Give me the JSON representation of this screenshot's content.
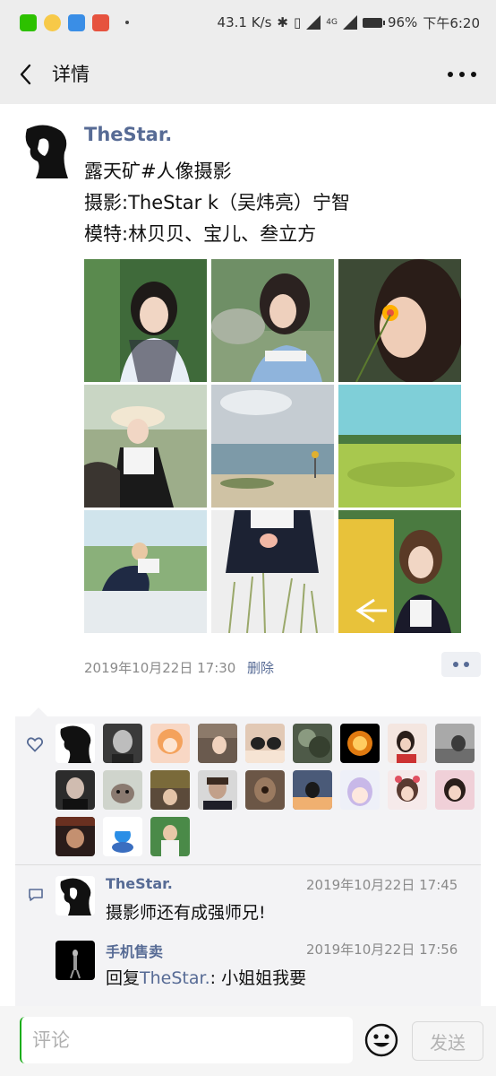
{
  "status_bar": {
    "network_speed": "43.1 K/s",
    "battery": "96%",
    "time": "下午6:20",
    "app_icons": [
      "wechat-icon",
      "qq-icon",
      "app-icon",
      "weibo-icon"
    ],
    "colors": {
      "wechat": "#2dc100",
      "qq": "#f7c948",
      "app": "#3a8ee6",
      "weibo": "#e6533f"
    }
  },
  "header": {
    "title": "详情"
  },
  "post": {
    "author": "TheStar.",
    "lines": [
      "露天矿#人像摄影",
      "摄影:TheStar k（吴炜亮）宁智",
      "模特:林贝贝、宝儿、叁立方"
    ],
    "photos": [
      "portrait-girl-garden",
      "portrait-girl-lakeside",
      "portrait-girl-flower",
      "girl-sitting-bench",
      "beach-landscape",
      "yellow-wetland",
      "girl-crouching-shore",
      "girl-in-grass",
      "girl-yellow-sign"
    ],
    "timestamp": "2019年10月22日 17:30",
    "delete_label": "删除"
  },
  "likes": {
    "count_avatars": 21
  },
  "comments": [
    {
      "author": "TheStar.",
      "time": "2019年10月22日 17:45",
      "text": "摄影师还有成强师兄!"
    },
    {
      "author": "手机售卖",
      "time": "2019年10月22日 17:56",
      "reply_prefix": "回复",
      "reply_to": "TheStar.",
      "reply_suffix": ": 小姐姐我要"
    }
  ],
  "input_bar": {
    "placeholder": "评论",
    "send_label": "发送"
  },
  "colors": {
    "link": "#576b95",
    "panel_bg": "#f3f3f5",
    "header_bg": "#ededed"
  }
}
